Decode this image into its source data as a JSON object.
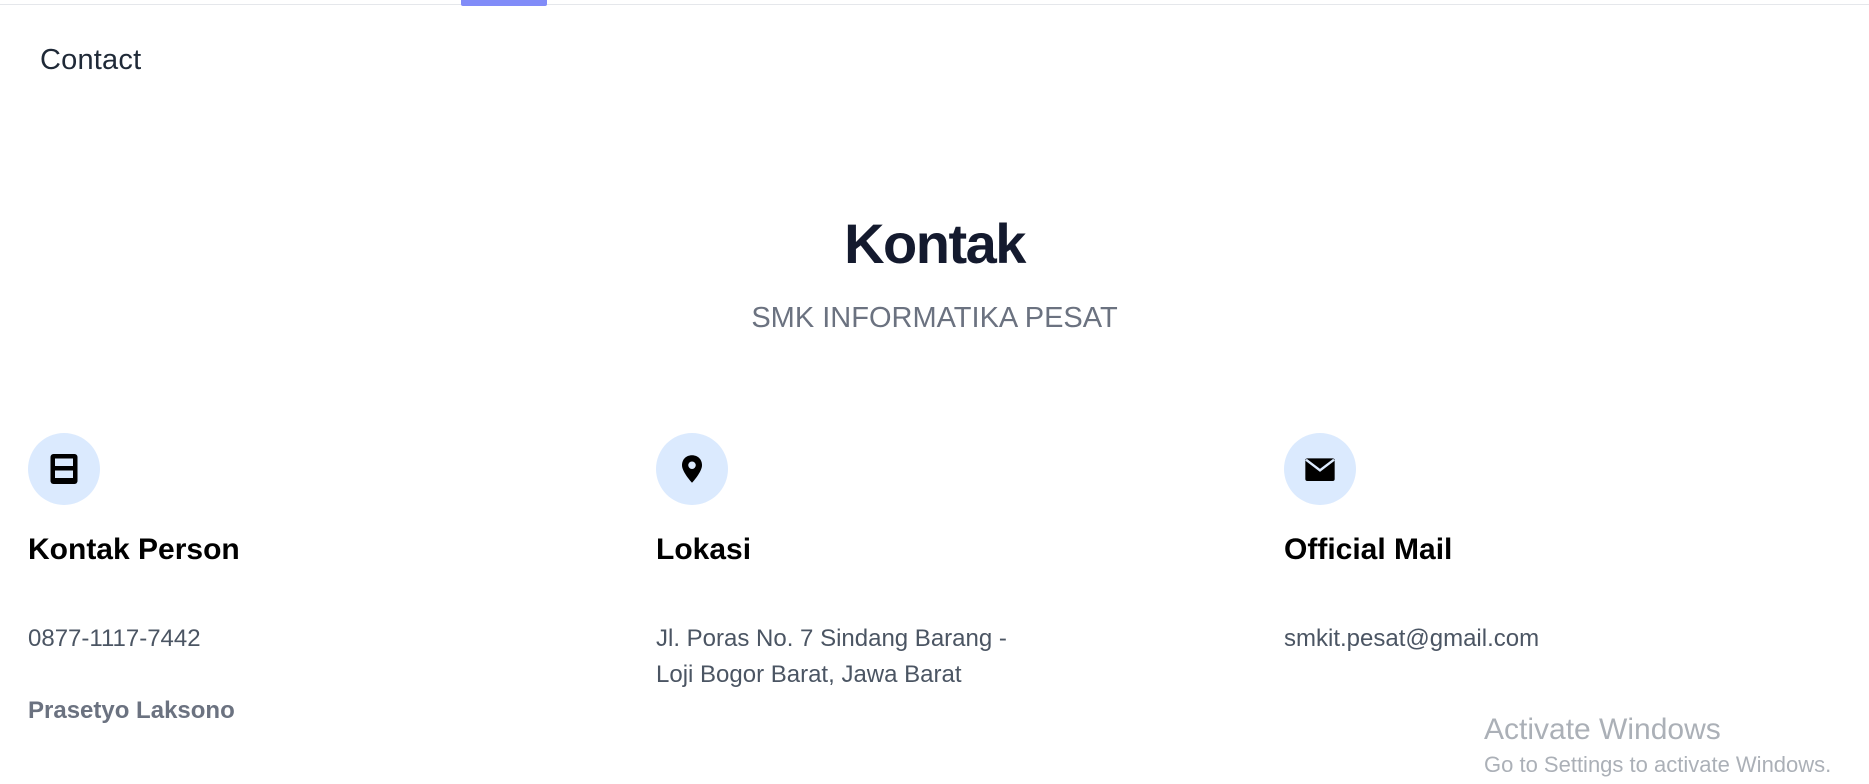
{
  "nav": {
    "contact_label": "Contact"
  },
  "header": {
    "title": "Kontak",
    "subtitle": "SMK INFORMATIKA PESAT"
  },
  "cards": [
    {
      "icon": "phone-icon",
      "title": "Kontak Person",
      "text": "0877-1117-7442",
      "person": "Prasetyo Laksono"
    },
    {
      "icon": "location-pin-icon",
      "title": "Lokasi",
      "text": "Jl. Poras No. 7 Sindang Barang - Loji Bogor Barat, Jawa Barat"
    },
    {
      "icon": "mail-icon",
      "title": "Official Mail",
      "text": "smkit.pesat@gmail.com"
    }
  ],
  "watermark": {
    "title": "Activate Windows",
    "subtitle": "Go to Settings to activate Windows."
  },
  "colors": {
    "accent_indicator": "#818cf8",
    "icon_circle_bg": "#dbeafe",
    "title_color": "#141a2e",
    "muted_text": "#6b7280"
  }
}
